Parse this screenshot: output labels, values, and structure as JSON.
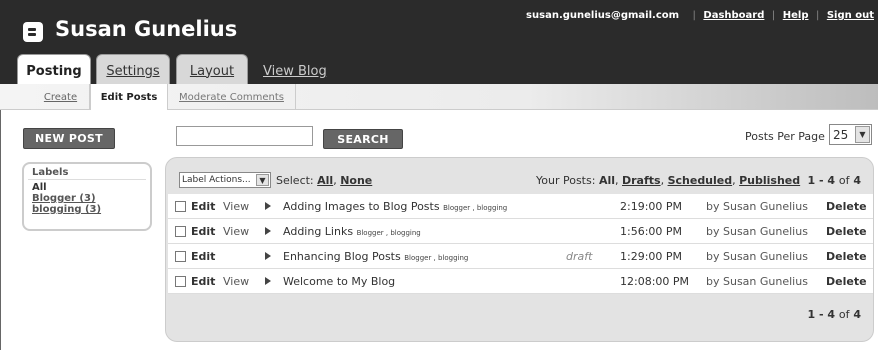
{
  "header": {
    "site_title": "Susan Gunelius",
    "email": "susan.gunelius@gmail.com",
    "links": {
      "dashboard": "Dashboard",
      "help": "Help",
      "sign_out": "Sign out"
    },
    "separator": "|"
  },
  "tabs": {
    "posting": "Posting",
    "settings": "Settings",
    "layout": "Layout",
    "view_blog": "View Blog"
  },
  "subnav": {
    "create": "Create",
    "edit_posts": "Edit Posts",
    "moderate_comments": "Moderate Comments"
  },
  "toolbar": {
    "new_post": "NEW POST",
    "search_value": "",
    "search_button": "SEARCH",
    "posts_per_page_label": "Posts Per Page",
    "posts_per_page_value": "25"
  },
  "labels": {
    "title": "Labels",
    "all": "All",
    "items": [
      "Blogger (3)",
      "blogging (3)"
    ]
  },
  "list_header": {
    "label_actions": "Label Actions...",
    "select_prefix": "Select:",
    "select_all": "All",
    "select_sep": ",",
    "select_none": "None",
    "your_posts_prefix": "Your Posts:",
    "filter_all": "All",
    "filter_drafts": "Drafts",
    "filter_scheduled": "Scheduled",
    "filter_published": "Published",
    "comma": ","
  },
  "pager": {
    "range": "1 - 4",
    "of": "of",
    "total": "4"
  },
  "posts": [
    {
      "edit": "Edit",
      "view": "View",
      "title": "Adding Images to Blog Posts",
      "tags": "Blogger , blogging",
      "status": "",
      "time": "2:19:00 PM",
      "author": "by Susan Gunelius",
      "delete": "Delete"
    },
    {
      "edit": "Edit",
      "view": "View",
      "title": "Adding Links",
      "tags": "Blogger , blogging",
      "status": "",
      "time": "1:56:00 PM",
      "author": "by Susan Gunelius",
      "delete": "Delete"
    },
    {
      "edit": "Edit",
      "view": "",
      "title": "Enhancing Blog Posts",
      "tags": "Blogger , blogging",
      "status": "draft",
      "time": "1:29:00 PM",
      "author": "by Susan Gunelius",
      "delete": "Delete"
    },
    {
      "edit": "Edit",
      "view": "View",
      "title": "Welcome to My Blog",
      "tags": "",
      "status": "",
      "time": "12:08:00 PM",
      "author": "by Susan Gunelius",
      "delete": "Delete"
    }
  ]
}
